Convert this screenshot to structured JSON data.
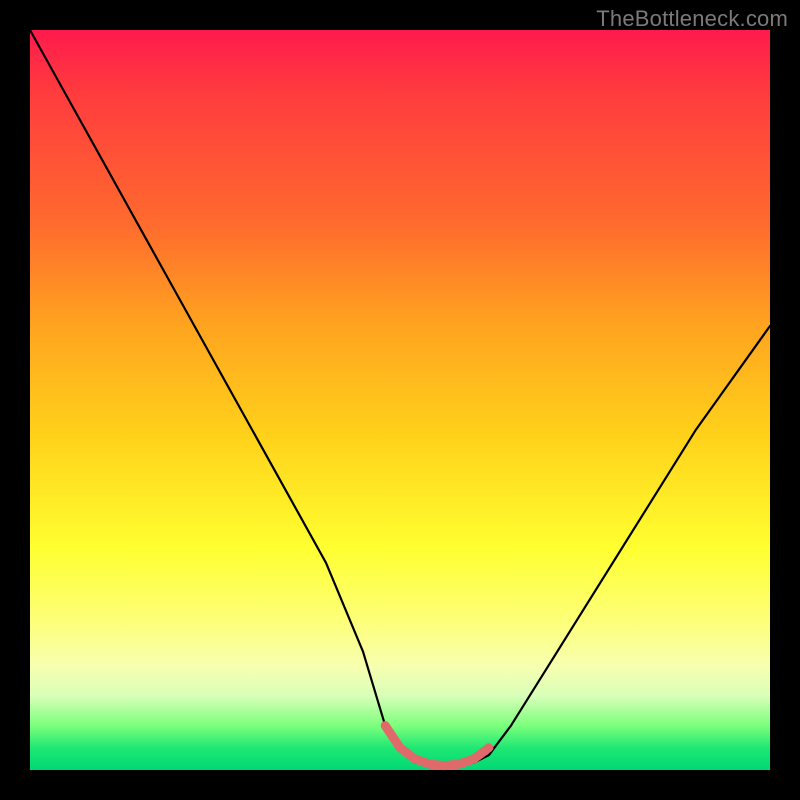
{
  "watermark": "TheBottleneck.com",
  "colors": {
    "frame": "#000000",
    "curve": "#000000",
    "trough_highlight": "#e06a6a",
    "gradient_top": "#ff1a4d",
    "gradient_bottom": "#00d874"
  },
  "chart_data": {
    "type": "line",
    "title": "",
    "xlabel": "",
    "ylabel": "",
    "xlim": [
      0,
      100
    ],
    "ylim": [
      0,
      100
    ],
    "grid": false,
    "series": [
      {
        "name": "bottleneck-curve",
        "x": [
          0,
          5,
          10,
          15,
          20,
          25,
          30,
          35,
          40,
          45,
          48,
          50,
          52,
          55,
          58,
          60,
          62,
          65,
          70,
          75,
          80,
          85,
          90,
          95,
          100
        ],
        "values": [
          100,
          91,
          82,
          73,
          64,
          55,
          46,
          37,
          28,
          16,
          6,
          3,
          1,
          0.5,
          0.5,
          1,
          2,
          6,
          14,
          22,
          30,
          38,
          46,
          53,
          60
        ]
      }
    ],
    "trough_highlight": {
      "x": [
        48,
        50,
        52,
        54,
        56,
        58,
        60,
        62
      ],
      "values": [
        6,
        3,
        1.5,
        0.8,
        0.6,
        0.8,
        1.5,
        3
      ]
    }
  }
}
